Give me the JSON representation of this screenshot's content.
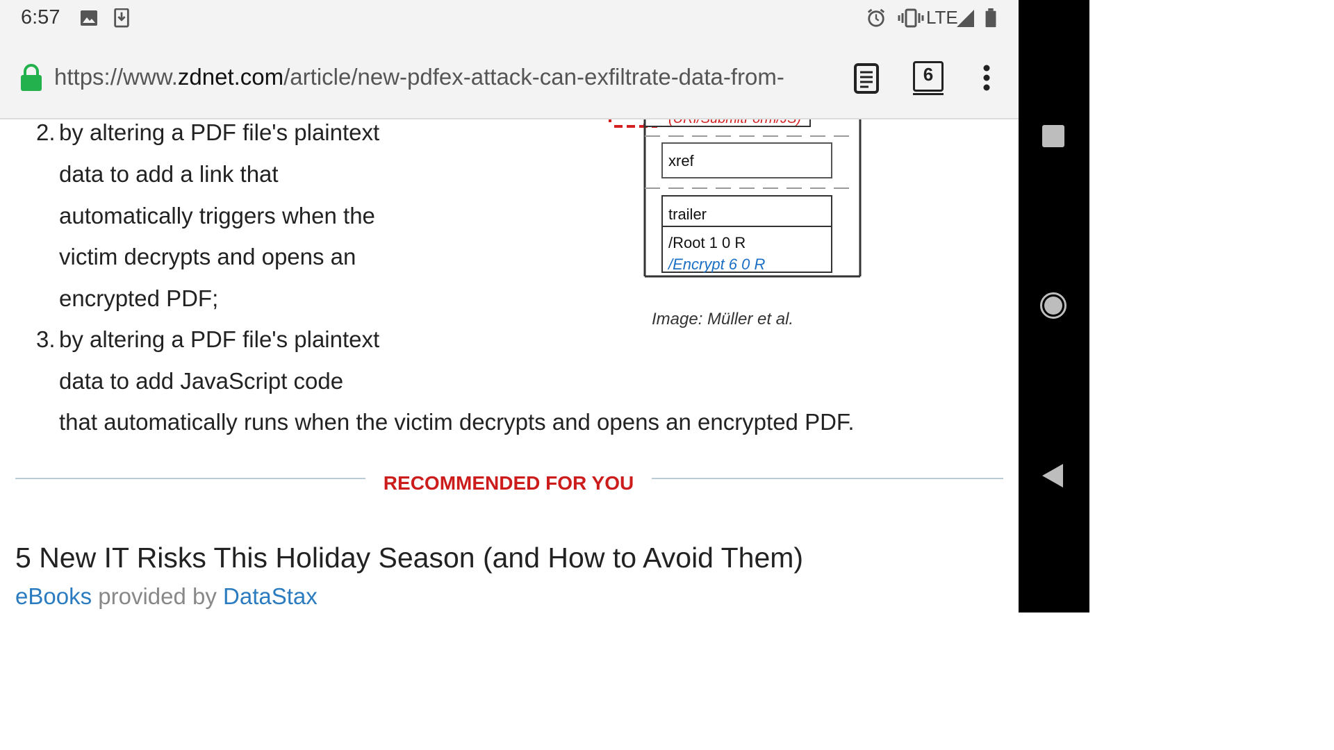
{
  "status_bar": {
    "time": "6:57",
    "icons": [
      "image-icon",
      "download-icon",
      "alarm-icon",
      "vibrate-icon",
      "signal-icon",
      "battery-icon"
    ],
    "network": "LTE"
  },
  "url_bar": {
    "scheme": "https://www.",
    "domain": "zdnet.com",
    "path": "/article/new-pdfex-attack-can-exfiltrate-data-from-",
    "tab_count": "6",
    "colors": {
      "lock": "#22b14c"
    }
  },
  "article": {
    "list_items": [
      {
        "number": "2.",
        "lines": [
          "by altering a PDF file's plaintext",
          "data to add a link that",
          "automatically triggers when the",
          "victim decrypts and opens an",
          "encrypted PDF;"
        ]
      },
      {
        "number": "3.",
        "lines": [
          "by altering a PDF file's plaintext",
          "data to add JavaScript code",
          "that automatically runs when the victim decrypts and opens an encrypted PDF."
        ]
      }
    ],
    "figure": {
      "top_fragment": "(URI/SubmitForm/JS)",
      "xref": "xref",
      "trailer": "trailer",
      "root": "/Root 1 0 R",
      "encrypt": "/Encrypt 6 0 R",
      "caption": "Image: Müller et al."
    }
  },
  "recommended": {
    "heading": "RECOMMENDED FOR YOU",
    "title": "5 New IT Risks This Holiday Season (and How to Avoid Them)",
    "type_link": "eBooks",
    "provided_by": "provided by",
    "provider_link": "DataStax",
    "colors": {
      "heading": "#cc1c1c",
      "link": "#2a7bbf"
    }
  },
  "nav_bar": {
    "buttons": [
      "recents-button",
      "home-button",
      "back-button"
    ]
  }
}
